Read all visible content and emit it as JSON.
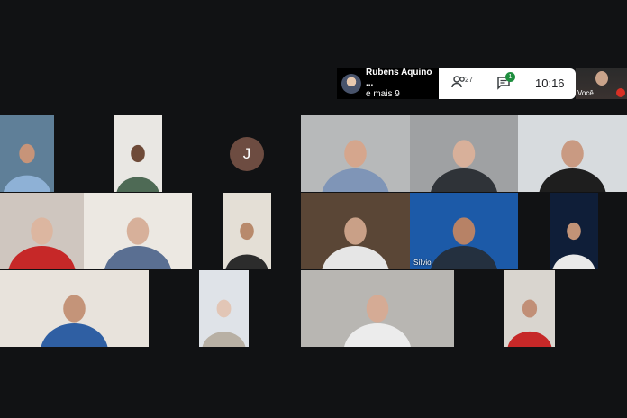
{
  "meeting": {
    "speaker_name": "Rubens Aquino ...",
    "speaker_more": "e mais 9",
    "participants_count": "27",
    "chat_unread": "1",
    "clock": "10:16",
    "self_label": "Você"
  },
  "avatar_tile": {
    "initial": "J"
  },
  "tiles": [
    {
      "id": "p1",
      "name": "",
      "bg": "#5f7f98",
      "skin": "#c79479",
      "shirt": "#8eb1d6"
    },
    {
      "id": "p2",
      "name": "",
      "bg": "#e9e7e3",
      "skin": "#6e4a38",
      "shirt": "#4e6a55"
    },
    {
      "id": "p3",
      "name": "",
      "bg": "#cfc6bf",
      "skin": "#dcb6a0",
      "shirt": "#c62828"
    },
    {
      "id": "p4",
      "name": "",
      "bg": "#ece8e2",
      "skin": "#d7b09a",
      "shirt": "#5a6f92"
    },
    {
      "id": "p5",
      "name": "",
      "bg": "#e4dfd6",
      "skin": "#b88a6c",
      "shirt": "#2c2c2c"
    },
    {
      "id": "p6",
      "name": "",
      "bg": "#e8e3dc",
      "skin": "#c49479",
      "shirt": "#2f5fa3"
    },
    {
      "id": "p7",
      "name": "",
      "bg": "#dfe3e8",
      "skin": "#e2c6b6",
      "shirt": "#b8b0a4"
    },
    {
      "id": "p8",
      "name": "",
      "bg": "#b7b9ba",
      "skin": "#d5a68d",
      "shirt": "#7f95b7"
    },
    {
      "id": "p9",
      "name": "",
      "bg": "#9fa1a3",
      "skin": "#d8b09a",
      "shirt": "#2f3338"
    },
    {
      "id": "p10",
      "name": "",
      "bg": "#d7dbde",
      "skin": "#c99a82",
      "shirt": "#1e1e1e"
    },
    {
      "id": "p11",
      "name": "",
      "bg": "#5a4636",
      "skin": "#c9a087",
      "shirt": "#e6e6e6"
    },
    {
      "id": "p12",
      "name": "Sílvio",
      "bg": "#1c5aa8",
      "skin": "#b78266",
      "shirt": "#24303f"
    },
    {
      "id": "p13",
      "name": "",
      "bg": "#0f1e38",
      "skin": "#c29377",
      "shirt": "#e9e9e9"
    },
    {
      "id": "p14",
      "name": "",
      "bg": "#b8b6b2",
      "skin": "#d5ab95",
      "shirt": "#ececec"
    },
    {
      "id": "p15",
      "name": "",
      "bg": "#d9d5cf",
      "skin": "#c18f77",
      "shirt": "#c62828"
    }
  ]
}
